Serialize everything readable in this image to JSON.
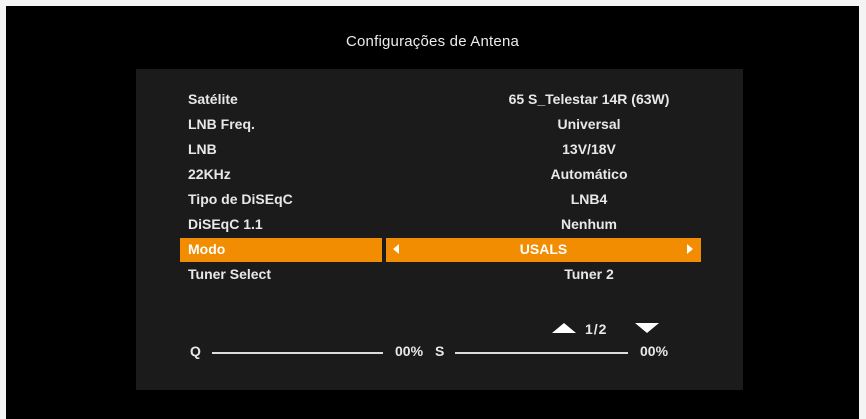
{
  "screen": {
    "title": "Configurações de Antena"
  },
  "settings": [
    {
      "label": "Satélite",
      "value": "65 S_Telestar 14R (63W)"
    },
    {
      "label": "LNB Freq.",
      "value": "Universal"
    },
    {
      "label": "LNB",
      "value": "13V/18V"
    },
    {
      "label": "22KHz",
      "value": "Automático"
    },
    {
      "label": "Tipo de DiSEqC",
      "value": "LNB4"
    },
    {
      "label": "DiSEqC 1.1",
      "value": "Nenhum"
    },
    {
      "label": "Modo",
      "value": "USALS",
      "selected": true
    },
    {
      "label": "Tuner Select",
      "value": "Tuner 2"
    }
  ],
  "pager": {
    "text": "1/2"
  },
  "signal": {
    "quality": {
      "label": "Q",
      "percent": "00%",
      "level": 0
    },
    "strength": {
      "label": "S",
      "percent": "00%",
      "level": 0
    }
  },
  "colors": {
    "highlight": "#f28c00",
    "background": "#000000",
    "panel": "#1b1b1b"
  }
}
